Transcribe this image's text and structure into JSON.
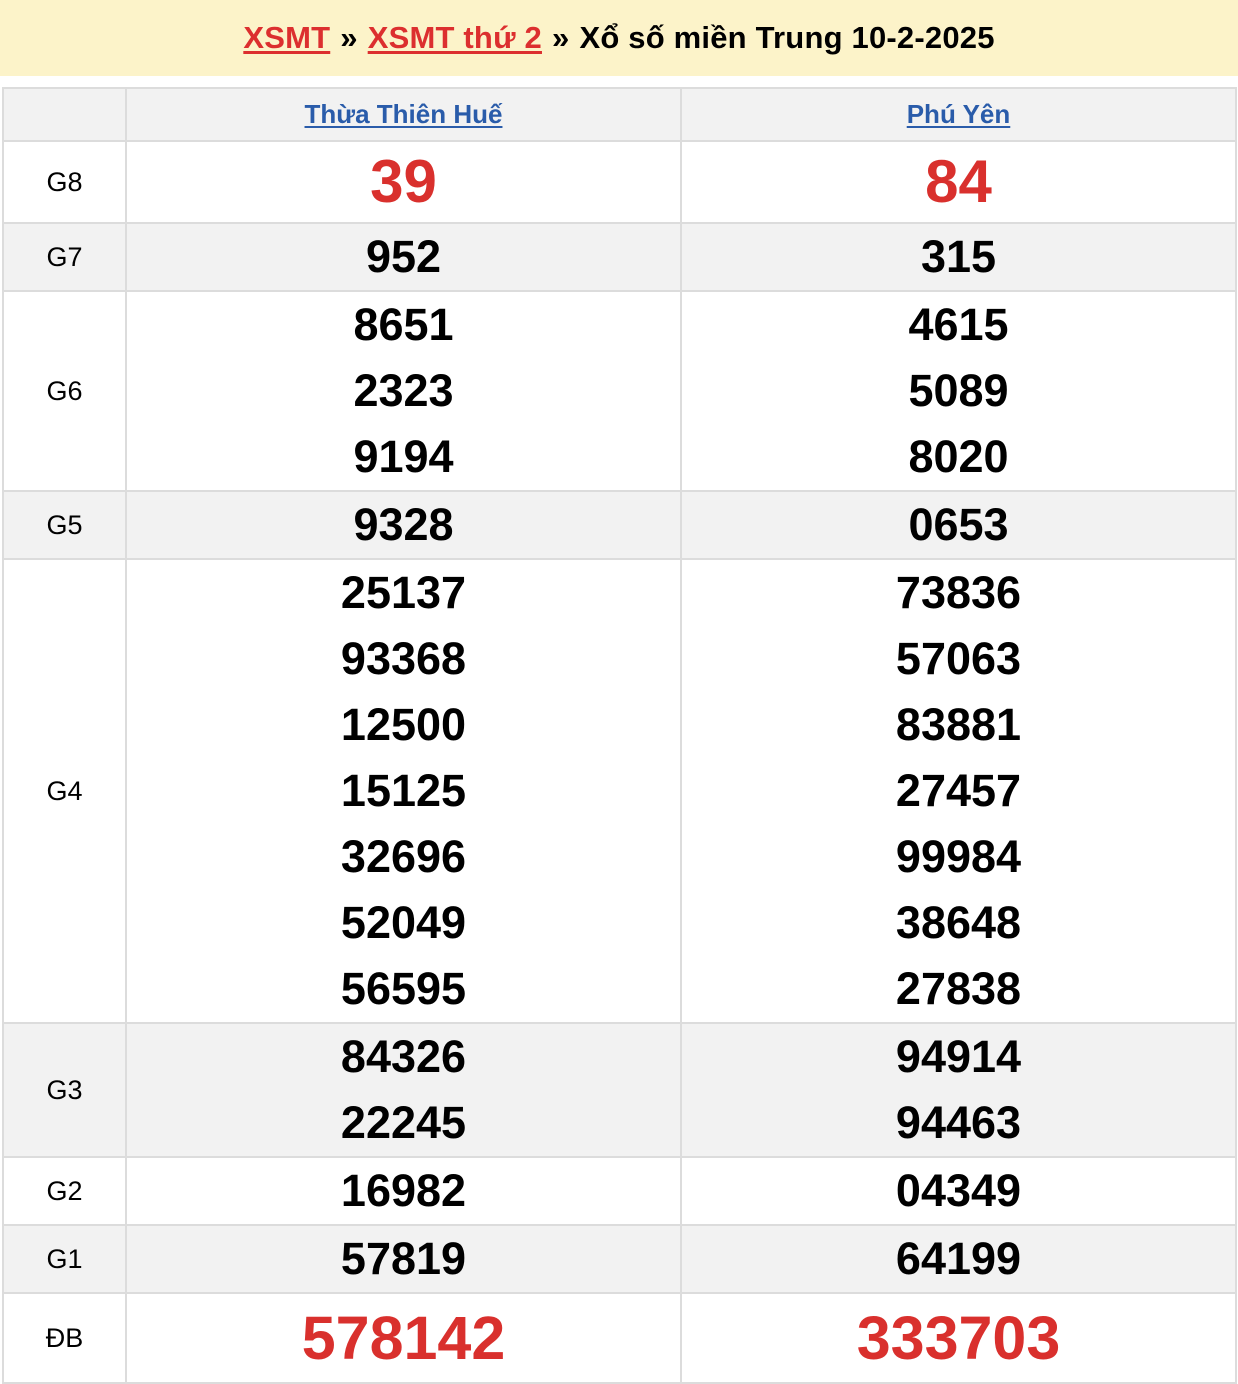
{
  "breadcrumb": {
    "link1": "XSMT",
    "sep1": "»",
    "link2": "XSMT thứ 2",
    "sep2": "»",
    "title": "Xổ số miền Trung 10-2-2025"
  },
  "colors": {
    "header_bg": "#fcf3c9",
    "accent_red": "#d9302d",
    "link_blue": "#2a5caa"
  },
  "provinces": [
    "Thừa Thiên Huế",
    "Phú Yên"
  ],
  "prizes": [
    {
      "label": "G8",
      "a": [
        "39"
      ],
      "b": [
        "84"
      ]
    },
    {
      "label": "G7",
      "a": [
        "952"
      ],
      "b": [
        "315"
      ]
    },
    {
      "label": "G6",
      "a": [
        "8651",
        "2323",
        "9194"
      ],
      "b": [
        "4615",
        "5089",
        "8020"
      ]
    },
    {
      "label": "G5",
      "a": [
        "9328"
      ],
      "b": [
        "0653"
      ]
    },
    {
      "label": "G4",
      "a": [
        "25137",
        "93368",
        "12500",
        "15125",
        "32696",
        "52049",
        "56595"
      ],
      "b": [
        "73836",
        "57063",
        "83881",
        "27457",
        "99984",
        "38648",
        "27838"
      ]
    },
    {
      "label": "G3",
      "a": [
        "84326",
        "22245"
      ],
      "b": [
        "94914",
        "94463"
      ]
    },
    {
      "label": "G2",
      "a": [
        "16982"
      ],
      "b": [
        "04349"
      ]
    },
    {
      "label": "G1",
      "a": [
        "57819"
      ],
      "b": [
        "64199"
      ]
    },
    {
      "label": "ĐB",
      "a": [
        "578142"
      ],
      "b": [
        "333703"
      ]
    }
  ]
}
